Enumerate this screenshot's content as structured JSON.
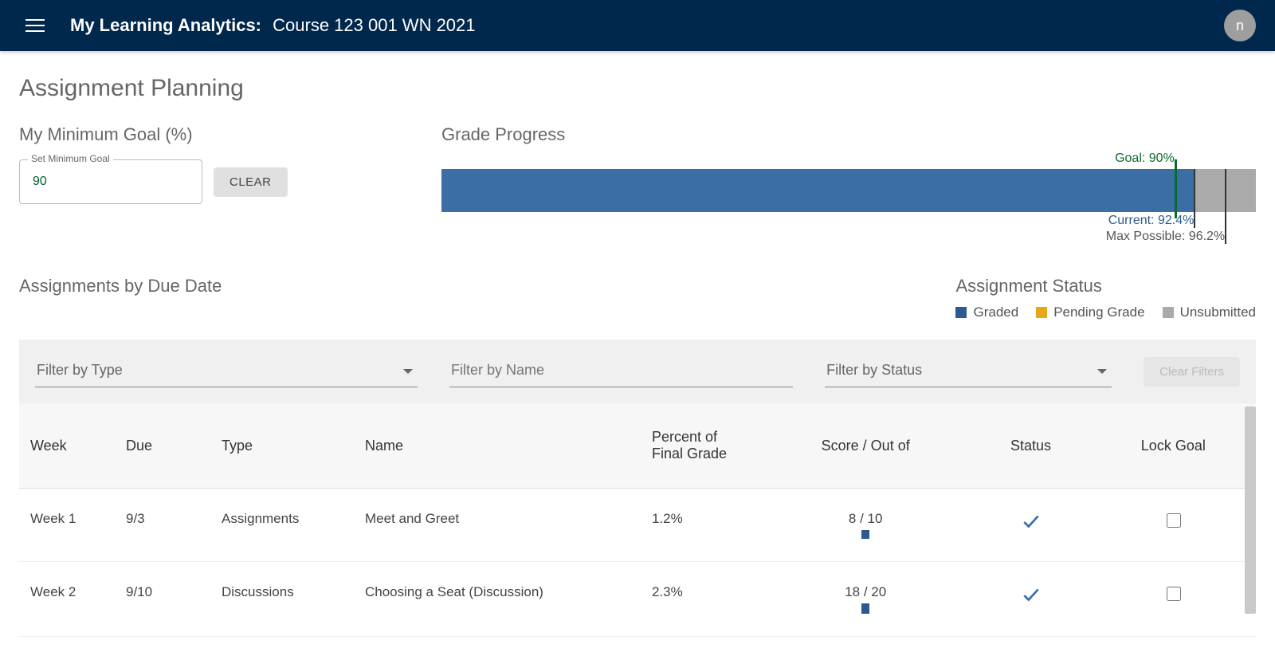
{
  "colors": {
    "brand_dark": "#00274c",
    "bar_fill": "#3a6ea5",
    "bar_track": "#aaaaaa",
    "goal_green": "#0a6b2d",
    "graded": "#2d5a8e",
    "pending": "#e6a817",
    "unsubmitted": "#aaaaaa"
  },
  "header": {
    "app_label": "My Learning Analytics:",
    "course": "Course 123 001 WN 2021",
    "avatar_initial": "n"
  },
  "page_title": "Assignment Planning",
  "goal": {
    "section_title": "My Minimum Goal (%)",
    "input_label": "Set Minimum Goal",
    "value": "90",
    "clear_label": "CLEAR"
  },
  "progress": {
    "section_title": "Grade Progress",
    "goal_pct": 90,
    "goal_label": "Goal: 90%",
    "current_pct": 92.4,
    "current_label": "Current: 92.4%",
    "max_pct": 96.2,
    "max_label": "Max Possible: 96.2%"
  },
  "assignments_header": "Assignments by Due Date",
  "status": {
    "title": "Assignment Status",
    "legend": [
      {
        "label": "Graded",
        "color": "#2d5a8e"
      },
      {
        "label": "Pending Grade",
        "color": "#e6a817"
      },
      {
        "label": "Unsubmitted",
        "color": "#aaaaaa"
      }
    ]
  },
  "filters": {
    "type_placeholder": "Filter by Type",
    "name_placeholder": "Filter by Name",
    "status_placeholder": "Filter by Status",
    "clear_label": "Clear Filters"
  },
  "table": {
    "columns": [
      "Week",
      "Due",
      "Type",
      "Name",
      "Percent of Final Grade",
      "Score / Out of",
      "Status",
      "Lock Goal"
    ],
    "rows": [
      {
        "week": "Week 1",
        "due": "9/3",
        "type": "Assignments",
        "name": "Meet and Greet",
        "pct": "1.2%",
        "score": "8 / 10",
        "score_ratio": 0.8,
        "status": "graded"
      },
      {
        "week": "Week 2",
        "due": "9/10",
        "type": "Discussions",
        "name": "Choosing a Seat (Discussion)",
        "pct": "2.3%",
        "score": "18 / 20",
        "score_ratio": 0.9,
        "status": "graded"
      }
    ]
  },
  "chart_data": {
    "type": "bar",
    "title": "Grade Progress",
    "xlabel": "",
    "ylabel": "",
    "categories": [
      "Current"
    ],
    "series": [
      {
        "name": "Current",
        "values": [
          92.4
        ]
      }
    ],
    "reference_lines": [
      {
        "name": "Goal",
        "value": 90
      },
      {
        "name": "Max Possible",
        "value": 96.2
      }
    ],
    "xlim": [
      0,
      100
    ],
    "ylim": [
      0,
      100
    ]
  }
}
